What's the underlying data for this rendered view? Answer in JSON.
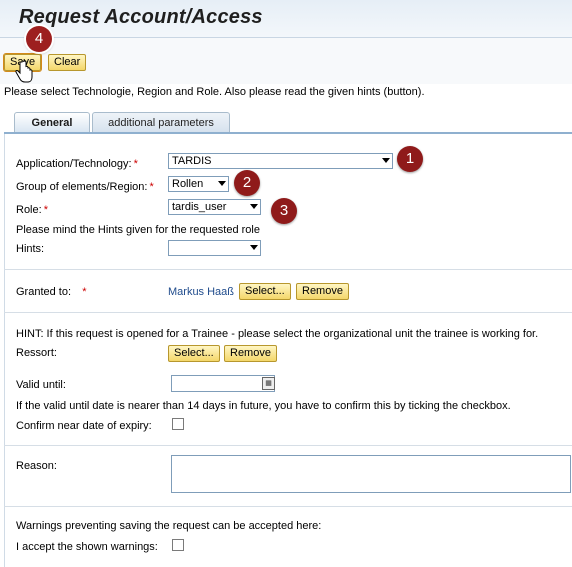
{
  "page": {
    "title": "Request Account/Access"
  },
  "toolbar": {
    "save_label": "Save",
    "clear_label": "Clear"
  },
  "instructions": "Please select Technologie, Region and Role. Also please read the given hints (button).",
  "tabs": [
    {
      "label": "General",
      "active": true
    },
    {
      "label": "additional parameters",
      "active": false
    }
  ],
  "form": {
    "application": {
      "label": "Application/Technology:",
      "required_mark": "*",
      "value": "TARDIS"
    },
    "group": {
      "label": "Group of elements/Region:",
      "required_mark": "*",
      "value": "Rollen"
    },
    "role": {
      "label": "Role:",
      "required_mark": "*",
      "value": "tardis_user"
    },
    "role_hint": "Please mind the Hints given for the requested role",
    "hints": {
      "label": "Hints:",
      "value": ""
    },
    "granted_to": {
      "label": "Granted to:",
      "required_mark": "*",
      "value": "Markus Haaß",
      "select_label": "Select...",
      "remove_label": "Remove"
    },
    "trainee_hint": "HINT: If this request is opened for a Trainee - please select the organizational unit the trainee is working for.",
    "ressort": {
      "label": "Ressort:",
      "select_label": "Select...",
      "remove_label": "Remove"
    },
    "valid_until": {
      "label": "Valid until:",
      "value": "",
      "calendar_icon": "calendar-icon"
    },
    "valid_hint": "If the valid until date is nearer than 14 days in future, you have to confirm this by ticking the checkbox.",
    "confirm_expiry": {
      "label": "Confirm near date of expiry:",
      "checked": false
    },
    "reason": {
      "label": "Reason:",
      "value": ""
    },
    "warnings_hint": "Warnings preventing saving the request can be accepted here:",
    "accept_warnings": {
      "label": "I accept the shown warnings:",
      "checked": false
    }
  },
  "annotations": {
    "badge_1": "1",
    "badge_2": "2",
    "badge_3": "3",
    "badge_4": "4",
    "badge_color": "#8f1a1a"
  },
  "colors": {
    "button_bg": "#f4d76a",
    "tab_accent": "#8fb0cf",
    "required": "#cc0000",
    "person_link": "#1f4b8c"
  }
}
